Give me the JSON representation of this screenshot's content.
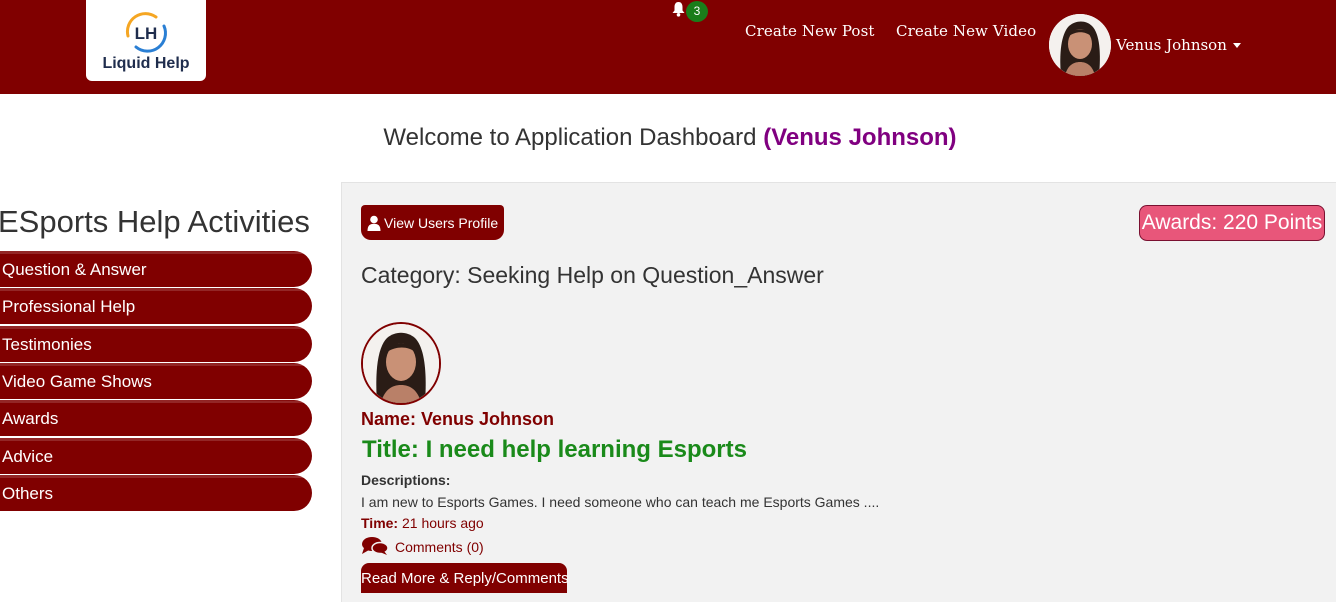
{
  "navbar": {
    "logo_initials": "LH",
    "logo_text": "Liquid Help",
    "notification_count": "3",
    "links": {
      "create_post": "Create New Post",
      "create_video": "Create New Video"
    },
    "user_name": "Venus Johnson",
    "bg_color": "#800000"
  },
  "welcome": {
    "text": "Welcome to Application Dashboard",
    "user": "(Venus Johnson)"
  },
  "sidebar": {
    "title": "ESports Help Activities",
    "items": [
      {
        "label": "Question & Answer"
      },
      {
        "label": "Professional Help"
      },
      {
        "label": "Testimonies"
      },
      {
        "label": "Video Game Shows"
      },
      {
        "label": "Awards"
      },
      {
        "label": "Advice"
      },
      {
        "label": "Others"
      }
    ]
  },
  "main": {
    "view_profile_label": "View Users Profile",
    "awards_label": "Awards: 220 Points",
    "category": "Category: Seeking Help on Question_Answer",
    "post": {
      "name": "Name: Venus Johnson",
      "title": "Title: I need help learning Esports",
      "desc_label": "Descriptions:",
      "desc": "I am new to Esports Games. I need someone who can teach me Esports Games ....",
      "time_label": "Time:",
      "time_value": "21 hours ago",
      "comments": "Comments (0)",
      "read_more": "Read More & Reply/Comments"
    }
  },
  "colors": {
    "accent": "#800000",
    "awards": "#e8567a",
    "title_green": "#1a8a1a",
    "welcome_user": "#800080"
  }
}
